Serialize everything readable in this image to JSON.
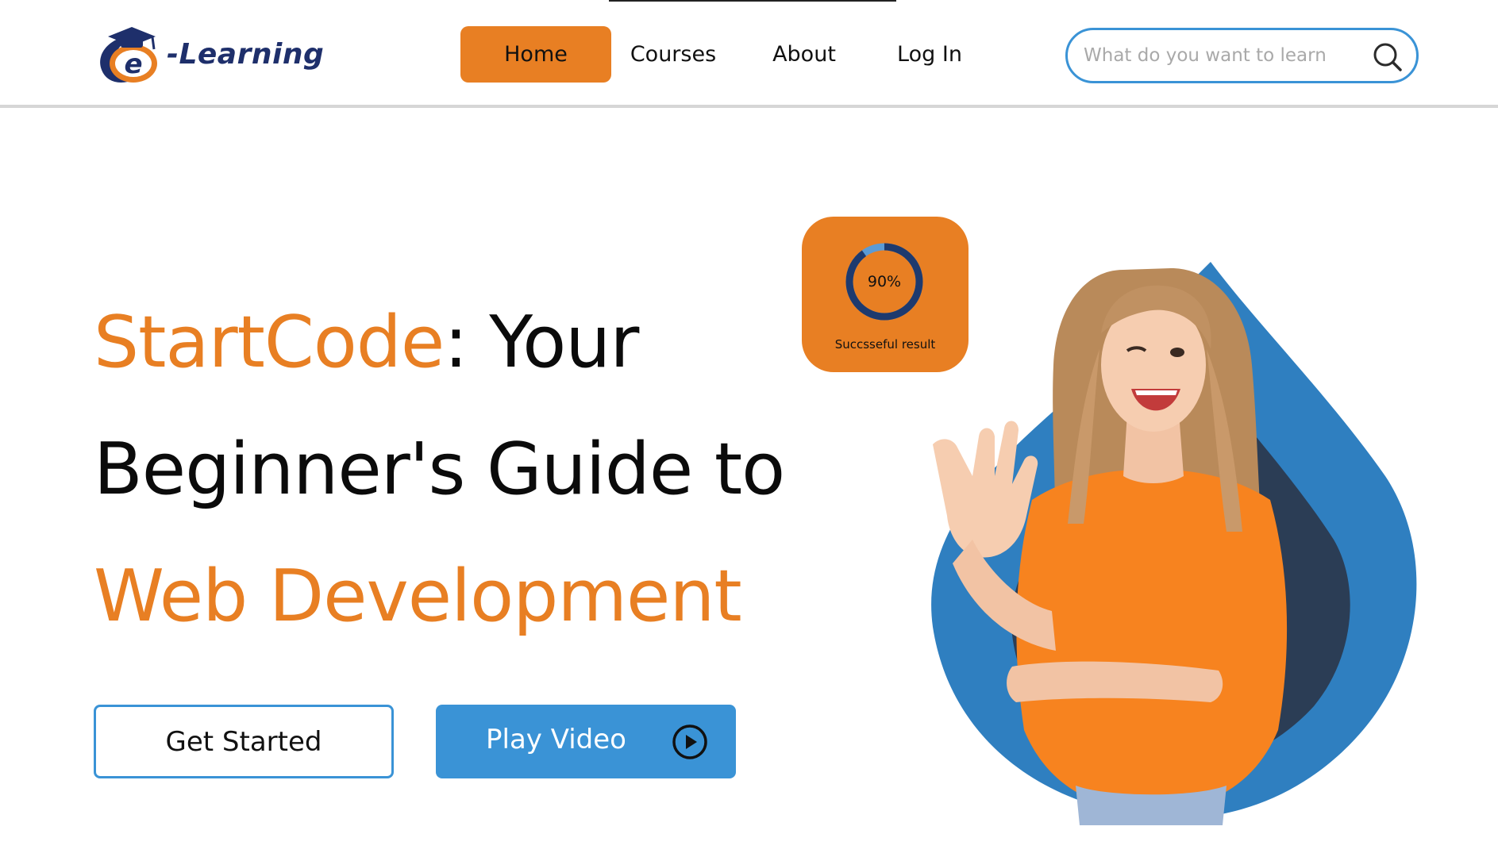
{
  "header": {
    "logo_text": "-Learning",
    "logo_letter": "e",
    "nav": {
      "home": "Home",
      "courses": "Courses",
      "about": "About",
      "login": "Log In"
    },
    "search": {
      "placeholder": "What do you want to learn",
      "value": ""
    }
  },
  "hero": {
    "title_part1": "StartCode",
    "title_part2": ": Your",
    "title_line2": "Beginner's Guide to",
    "title_line3": "Web Development",
    "primary_button": "Get Started",
    "secondary_button": "Play Video",
    "secondary_icon": "play-circle-icon"
  },
  "badge": {
    "progress": 0.9,
    "value_label": "90%",
    "caption": "Succsseful result"
  },
  "colors": {
    "accent_orange": "#e87f23",
    "accent_blue": "#3a93d6",
    "navy": "#1e2f6b"
  },
  "icons": {
    "search": "search-icon",
    "logo": "graduation-cap-icon"
  }
}
